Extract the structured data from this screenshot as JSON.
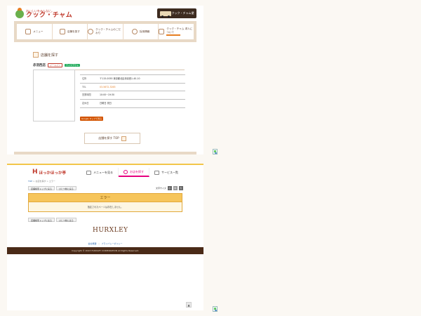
{
  "cookchum": {
    "logo_tagline": "おいしいをみんなに。",
    "logo_name": "クック・チャム",
    "banner_text": "クック・チャム便",
    "nav": [
      {
        "label": "メニュー",
        "icon": "bento-icon"
      },
      {
        "label": "店舗を探す",
        "icon": "store-icon"
      },
      {
        "label": "クック・チャムのこだわり",
        "icon": "chef-icon"
      },
      {
        "label": "採用情報",
        "icon": "people-icon"
      },
      {
        "label": "クック・チャム 求人について",
        "icon": "document-icon"
      }
    ],
    "section_title": "店舗を探す",
    "store_name": "赤羽西店",
    "tag_eat": "イートイン",
    "tag_take": "テイクアウト",
    "table": [
      {
        "key": "住所",
        "value": "〒115-0055 東京都北区赤羽西1-40-10"
      },
      {
        "key": "TEL",
        "value": "03-5672-3263"
      },
      {
        "key": "営業時間",
        "value": "10:00~19:30"
      },
      {
        "key": "定休日",
        "value": "日曜日 祝日"
      }
    ],
    "map_button": "Google マップで見る",
    "top_button": "店舗を探す TOP"
  },
  "hokka": {
    "logo_mark": "H",
    "logo_name": "ほっかほっか亭",
    "nav": [
      {
        "label": "メニューを見る"
      },
      {
        "label": "お店を探す"
      },
      {
        "label": "サービス一覧"
      }
    ],
    "breadcrumb": {
      "home": "TOP",
      "sep": " > ",
      "page": "お店を探す > エラー"
    },
    "chips": [
      "店舗検索トップに戻る",
      "ひとつ前に戻る"
    ],
    "fontsize_label": "文字サイズ",
    "fontsize_opts": [
      "小",
      "中",
      "大"
    ],
    "error_title": "エラー",
    "error_message": "指定されたページは存在しません。",
    "brand": "HURXLEY",
    "links": [
      "会社概要",
      "プライバシーポリシー"
    ],
    "copyright": "Copyright © 2023 HURXLEY CORPORATION All Rights Reserved."
  },
  "pagetop_glyph": "▲"
}
